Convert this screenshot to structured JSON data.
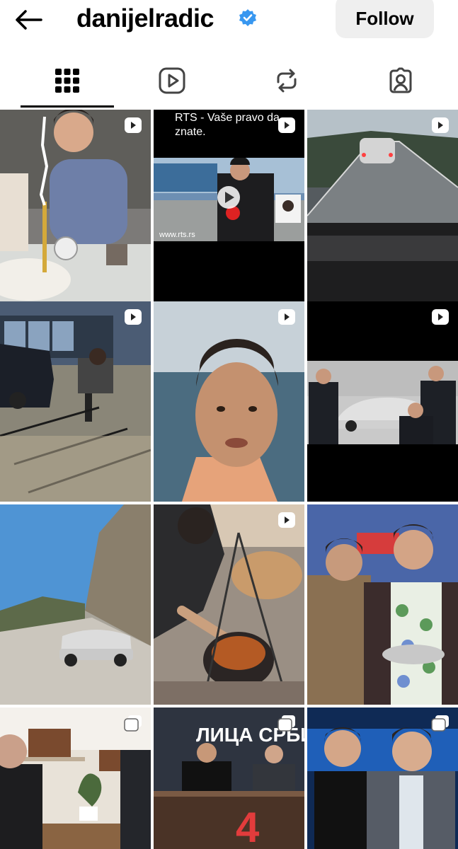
{
  "header": {
    "username": "danijelradic",
    "follow_label": "Follow",
    "verified_color": "#3897f0"
  },
  "tabs": [
    {
      "name": "posts",
      "icon": "grid-icon",
      "active": true
    },
    {
      "name": "reels",
      "icon": "reels-icon",
      "active": false
    },
    {
      "name": "reposts",
      "icon": "repost-icon",
      "active": false
    },
    {
      "name": "tagged",
      "icon": "tagged-icon",
      "active": false
    }
  ],
  "grid": {
    "posts": [
      {
        "type": "reel",
        "overlay_text": ""
      },
      {
        "type": "reel",
        "overlay_text": "RTS - Vaše pravo da znate.",
        "image_text": "www.rts.rs"
      },
      {
        "type": "reel",
        "overlay_text": ""
      },
      {
        "type": "reel",
        "overlay_text": ""
      },
      {
        "type": "reel",
        "overlay_text": ""
      },
      {
        "type": "reel",
        "overlay_text": ""
      },
      {
        "type": "photo",
        "overlay_text": ""
      },
      {
        "type": "reel",
        "overlay_text": ""
      },
      {
        "type": "photo",
        "overlay_text": ""
      },
      {
        "type": "carousel",
        "overlay_text": ""
      },
      {
        "type": "carousel",
        "overlay_text": "",
        "image_text": "ЛИЦА СРБИЈЕ"
      },
      {
        "type": "carousel",
        "overlay_text": ""
      }
    ]
  }
}
